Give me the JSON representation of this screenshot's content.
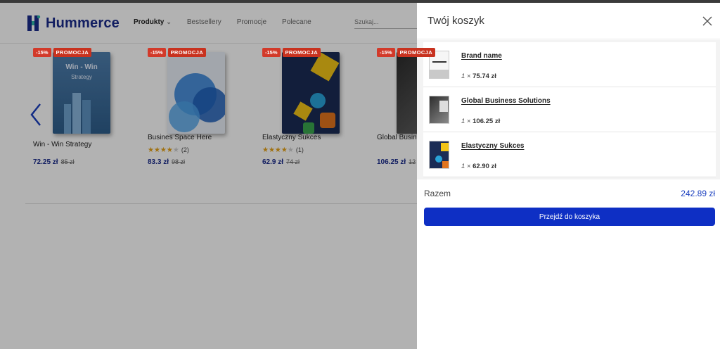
{
  "header": {
    "brand": "Hummerce",
    "nav": [
      {
        "label": "Produkty"
      },
      {
        "label": "Bestsellery"
      },
      {
        "label": "Promocje"
      },
      {
        "label": "Polecane"
      }
    ],
    "search_placeholder": "Szukaj..."
  },
  "products": [
    {
      "name": "Win - Win Strategy",
      "discount": "-15%",
      "promo": "PROMOCJA",
      "price": "72.25 zł",
      "old_price": "85 zł",
      "rating": null,
      "reviews": "",
      "cover_title": "Win - Win",
      "cover_subtitle": "Strategy"
    },
    {
      "name": "Busines Space Here",
      "discount": "-15%",
      "promo": "PROMOCJA",
      "price": "83.3 zł",
      "old_price": "98 zł",
      "rating": 4,
      "reviews": "(2)"
    },
    {
      "name": "Elastyczny Sukces",
      "discount": "-15%",
      "promo": "PROMOCJA",
      "price": "62.9 zł",
      "old_price": "74 zł",
      "rating": 4,
      "reviews": "(1)"
    },
    {
      "name": "Global Busin",
      "discount": "-15%",
      "promo": "PROMOCJA",
      "price": "106.25 zł",
      "old_price": "12",
      "rating": null,
      "reviews": ""
    }
  ],
  "cart": {
    "title": "Twój koszyk",
    "items": [
      {
        "name": "Brand name",
        "qty": "1",
        "price": "75.74 zł"
      },
      {
        "name": "Global Business Solutions",
        "qty": "1",
        "price": "106.25 zł"
      },
      {
        "name": "Elastyczny Sukces",
        "qty": "1",
        "price": "62.90 zł"
      }
    ],
    "qty_separator": "×",
    "total_label": "Razem",
    "total_value": "242.89 zł",
    "checkout_label": "Przejdź do koszyka"
  },
  "colors": {
    "brand": "#1a2b8c",
    "checkout": "#0e2fc4",
    "total": "#1a3fbf",
    "promo_badge": "#c8321f",
    "star": "#e6a319"
  }
}
